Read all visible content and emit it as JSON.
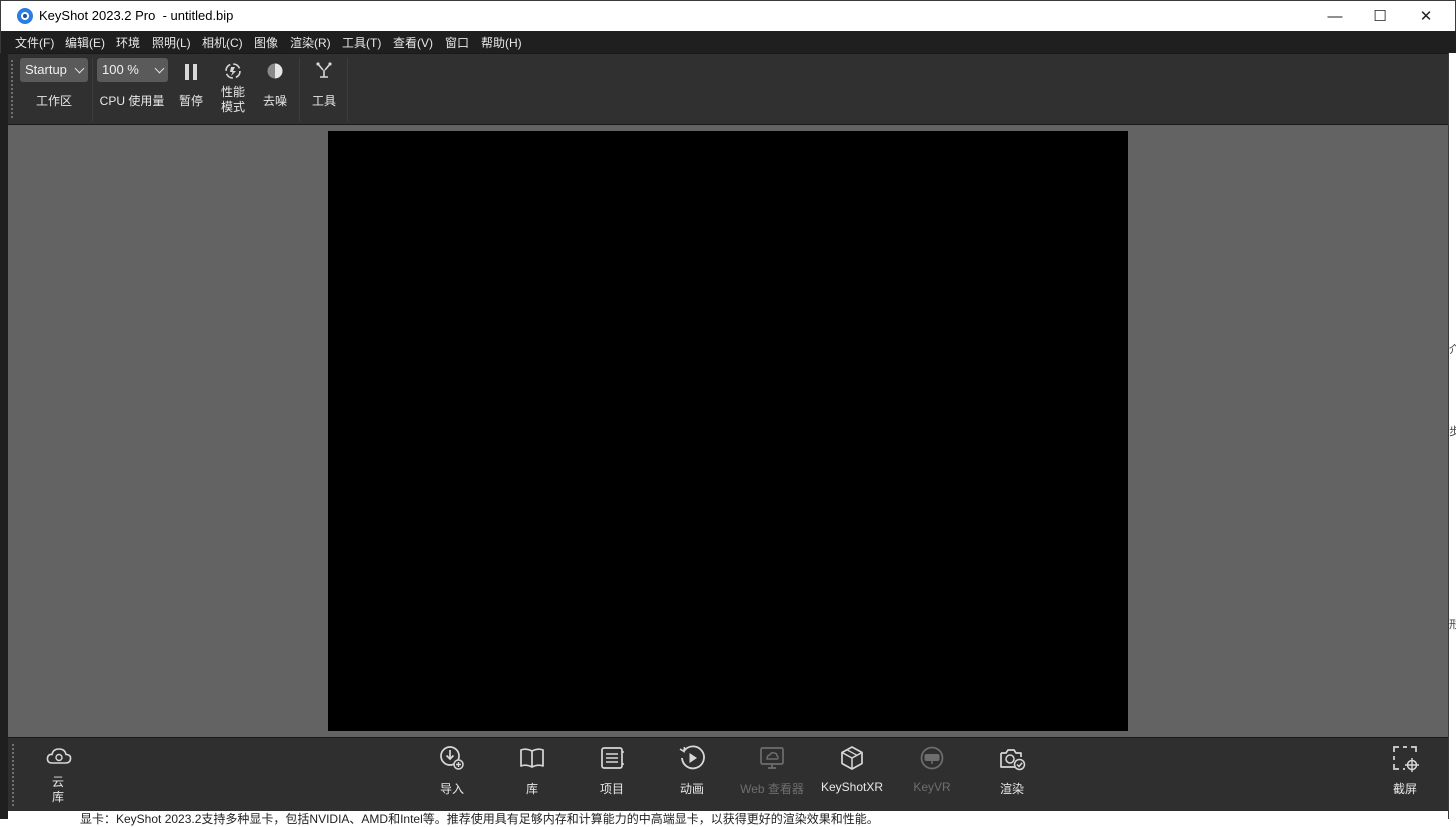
{
  "window": {
    "title": "KeyShot 2023.2 Pro  - untitled.bip",
    "minimize_glyph": "—",
    "maximize_glyph": "☐",
    "close_glyph": "✕"
  },
  "menu": [
    "文件(F)",
    "编辑(E)",
    "环境",
    "照明(L)",
    "相机(C)",
    "图像",
    "渲染(R)",
    "工具(T)",
    "查看(V)",
    "窗口",
    "帮助(H)"
  ],
  "ribbon": {
    "workspace_value": "Startup",
    "workspace_label": "工作区",
    "cpu_value": "100 %",
    "cpu_label": "CPU 使用量",
    "pause_label": "暂停",
    "perf_label_line1": "性能",
    "perf_label_line2": "模式",
    "denoise_label": "去噪",
    "tools_label": "工具"
  },
  "bottom": {
    "cloud_label_line1": "云",
    "cloud_label_line2": "库",
    "items": [
      {
        "label": "导入",
        "icon": "import-icon",
        "enabled": true
      },
      {
        "label": "库",
        "icon": "library-icon",
        "enabled": true
      },
      {
        "label": "项目",
        "icon": "project-icon",
        "enabled": true
      },
      {
        "label": "动画",
        "icon": "animation-icon",
        "enabled": true
      },
      {
        "label": "Web 查看器",
        "icon": "web-viewer-icon",
        "enabled": false
      },
      {
        "label": "KeyShotXR",
        "icon": "keyshotxr-icon",
        "enabled": true
      },
      {
        "label": "KeyVR",
        "icon": "keyvr-icon",
        "enabled": false
      },
      {
        "label": "渲染",
        "icon": "render-icon",
        "enabled": true
      }
    ],
    "screenshot_label": "截屏"
  },
  "underlying_text": "显卡：KeyShot 2023.2支持多种显卡，包括NVIDIA、AMD和Intel等。推荐使用具有足够内存和计算能力的中高端显卡，以获得更好的渲染效果和性能。",
  "edge_glyphs": [
    "介",
    "步",
    "形"
  ],
  "colors": {
    "viewport_bg": "#636363",
    "canvas_bg": "#000000",
    "toolbar_bg": "#303030",
    "menubar_bg": "#1f1f1f"
  }
}
